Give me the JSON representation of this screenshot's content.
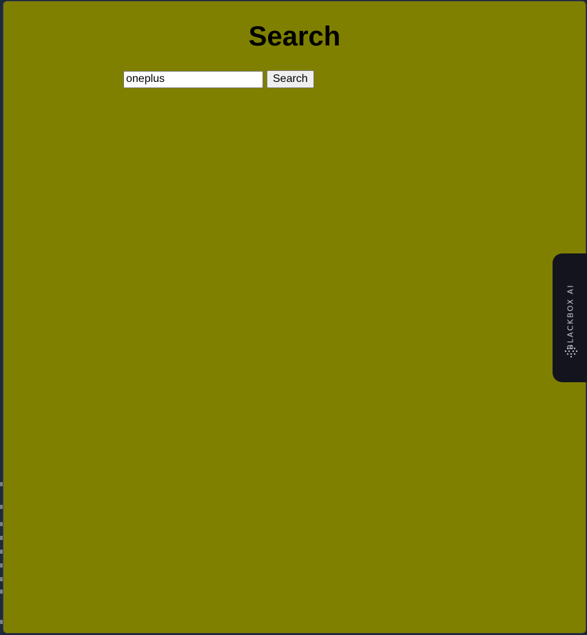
{
  "page": {
    "title": "Search"
  },
  "search": {
    "value": "oneplus",
    "button_label": "Search"
  },
  "side_widget": {
    "label": "BLACKBOX AI",
    "icon": "blackbox-logo-icon"
  },
  "colors": {
    "page_background": "#808000",
    "widget_background": "#13141d"
  }
}
